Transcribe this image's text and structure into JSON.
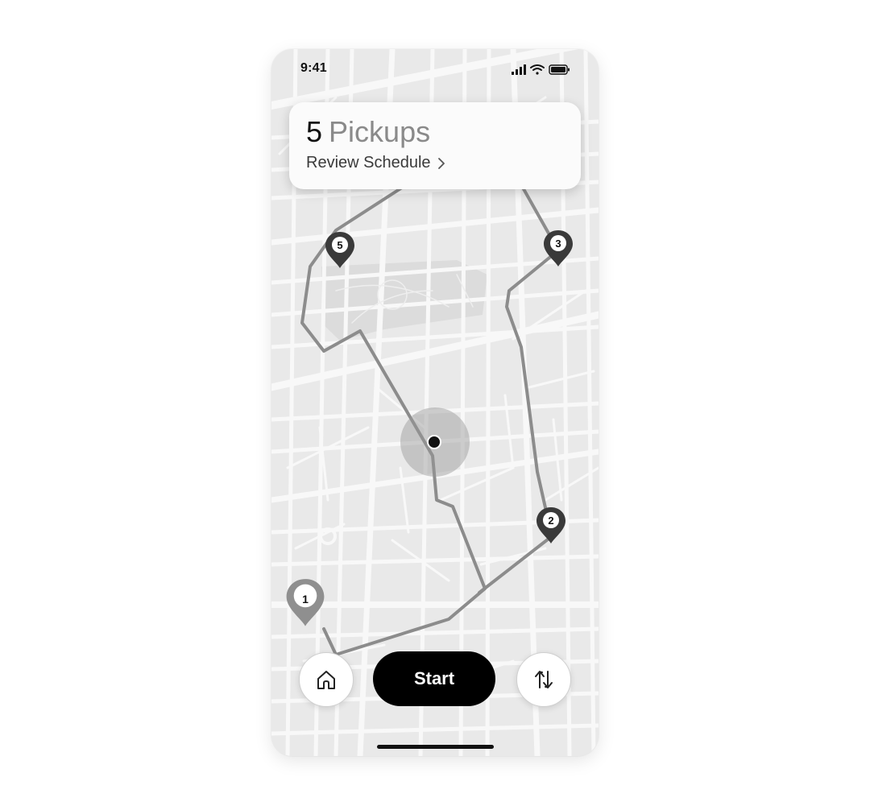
{
  "status_bar": {
    "time": "9:41",
    "icons": [
      "signal-icon",
      "wifi-icon",
      "battery-icon"
    ]
  },
  "summary_card": {
    "count": "5",
    "label": "Pickups",
    "link_label": "Review Schedule",
    "link_icon": "chevron-right-icon"
  },
  "pins": [
    {
      "label": "1",
      "state": "inactive"
    },
    {
      "label": "2",
      "state": "active"
    },
    {
      "label": "3",
      "state": "active"
    },
    {
      "label": "5",
      "state": "active"
    }
  ],
  "bottom_bar": {
    "start_label": "Start",
    "left_icon": "home-icon",
    "right_icon": "swap-route-icon"
  },
  "colors": {
    "map_bg": "#e9e9e9",
    "road": "#f7f7f7",
    "route": "#8c8c8c",
    "pin_active": "#3a3a3a",
    "pin_inactive": "#8f8f8f",
    "primary_button": "#000000"
  }
}
